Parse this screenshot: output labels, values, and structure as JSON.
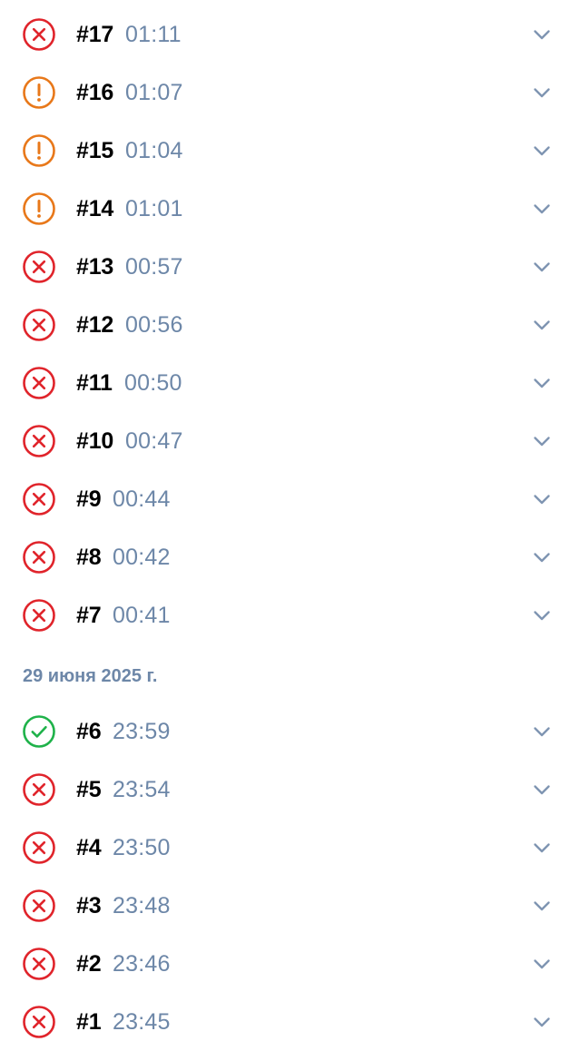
{
  "colors": {
    "error": "#e0242b",
    "warning": "#e8781a",
    "success": "#1fb24a",
    "time": "#6d87a8",
    "chevron": "#7f95b2",
    "date_header": "#6d87a8"
  },
  "icons": {
    "error": "x-circle-icon",
    "warning": "exclamation-circle-icon",
    "success": "check-circle-icon",
    "expand": "chevron-down-icon"
  },
  "groups": [
    {
      "date": "",
      "runs": [
        {
          "num": "#17",
          "time": "01:11",
          "status": "error"
        },
        {
          "num": "#16",
          "time": "01:07",
          "status": "warning"
        },
        {
          "num": "#15",
          "time": "01:04",
          "status": "warning"
        },
        {
          "num": "#14",
          "time": "01:01",
          "status": "warning"
        },
        {
          "num": "#13",
          "time": "00:57",
          "status": "error"
        },
        {
          "num": "#12",
          "time": "00:56",
          "status": "error"
        },
        {
          "num": "#11",
          "time": "00:50",
          "status": "error"
        },
        {
          "num": "#10",
          "time": "00:47",
          "status": "error"
        },
        {
          "num": "#9",
          "time": "00:44",
          "status": "error"
        },
        {
          "num": "#8",
          "time": "00:42",
          "status": "error"
        },
        {
          "num": "#7",
          "time": "00:41",
          "status": "error"
        }
      ]
    },
    {
      "date": "29 июня 2025 г.",
      "runs": [
        {
          "num": "#6",
          "time": "23:59",
          "status": "success"
        },
        {
          "num": "#5",
          "time": "23:54",
          "status": "error"
        },
        {
          "num": "#4",
          "time": "23:50",
          "status": "error"
        },
        {
          "num": "#3",
          "time": "23:48",
          "status": "error"
        },
        {
          "num": "#2",
          "time": "23:46",
          "status": "error"
        },
        {
          "num": "#1",
          "time": "23:45",
          "status": "error"
        }
      ]
    }
  ]
}
